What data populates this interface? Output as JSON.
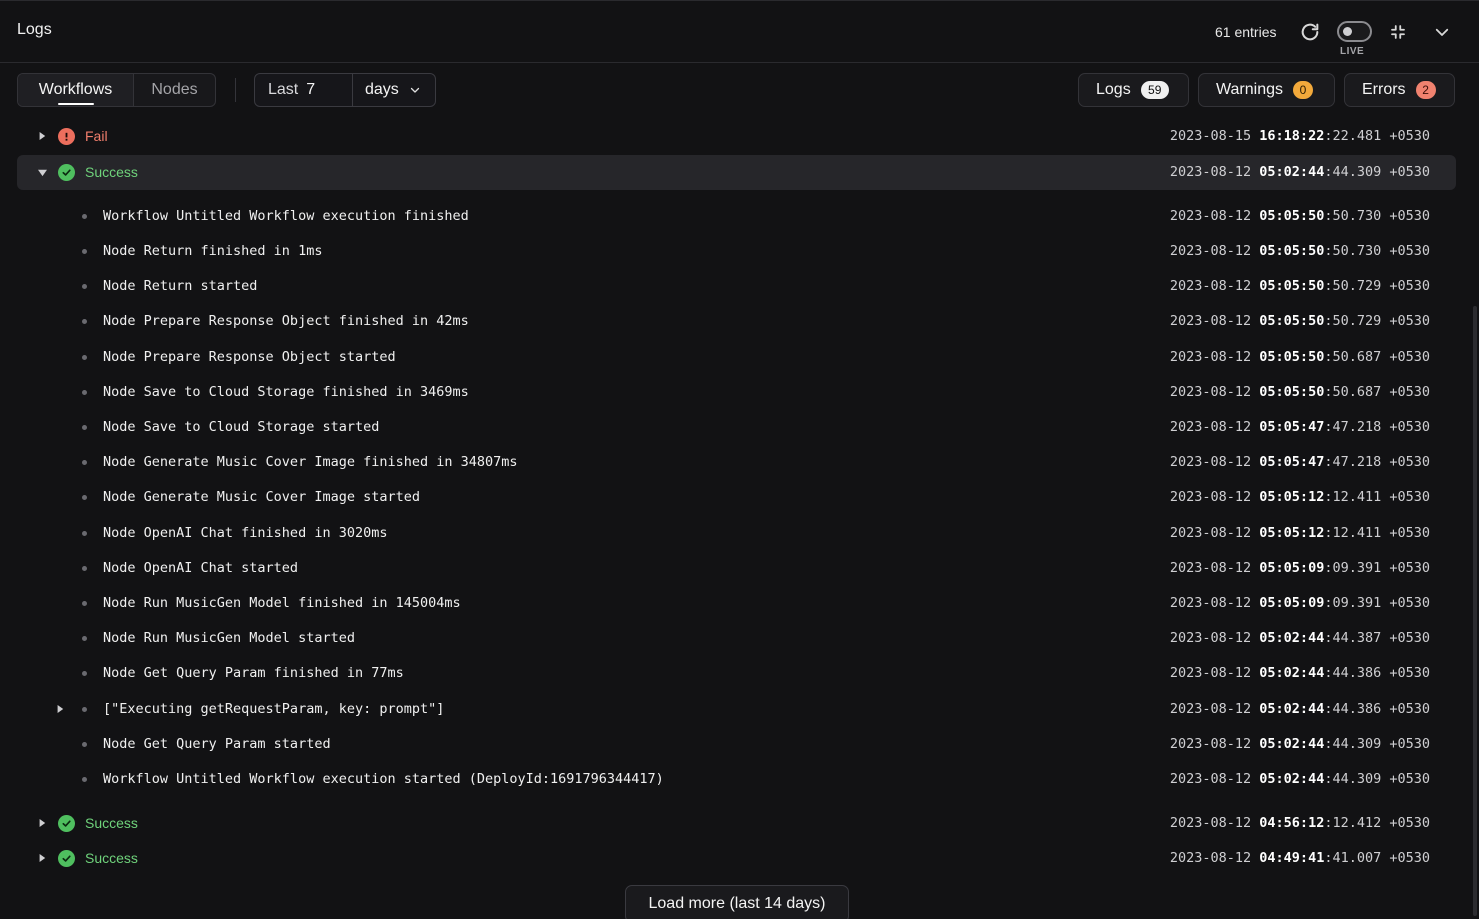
{
  "header": {
    "title": "Logs",
    "entries_count": "61 entries",
    "live_label": "LIVE",
    "live_enabled": false
  },
  "toolbar": {
    "tabs": [
      {
        "label": "Workflows",
        "active": true
      },
      {
        "label": "Nodes",
        "active": false
      }
    ],
    "range": {
      "prefix": "Last",
      "value": "7",
      "unit": "days"
    },
    "filters": [
      {
        "label": "Logs",
        "count": "59",
        "color": "#f1f1f1"
      },
      {
        "label": "Warnings",
        "count": "0",
        "color": "#f2a93b"
      },
      {
        "label": "Errors",
        "count": "2",
        "color": "#f0826f"
      }
    ]
  },
  "runs": [
    {
      "status": "Fail",
      "kind": "fail",
      "expanded": false,
      "ts_date": "2023-08-15",
      "ts_bold": "16:18:22",
      "ts_rest": ":22.481 +0530"
    },
    {
      "status": "Success",
      "kind": "ok",
      "expanded": true,
      "ts_date": "2023-08-12",
      "ts_bold": "05:02:44",
      "ts_rest": ":44.309 +0530"
    },
    {
      "status": "Success",
      "kind": "ok",
      "expanded": false,
      "ts_date": "2023-08-12",
      "ts_bold": "04:56:12",
      "ts_rest": ":12.412 +0530"
    },
    {
      "status": "Success",
      "kind": "ok",
      "expanded": false,
      "ts_date": "2023-08-12",
      "ts_bold": "04:49:41",
      "ts_rest": ":41.007 +0530"
    }
  ],
  "entries": [
    {
      "msg": "Workflow Untitled Workflow execution finished",
      "ts_date": "2023-08-12",
      "ts_bold": "05:05:50",
      "ts_rest": ":50.730 +0530"
    },
    {
      "msg": "Node Return finished in 1ms",
      "ts_date": "2023-08-12",
      "ts_bold": "05:05:50",
      "ts_rest": ":50.730 +0530"
    },
    {
      "msg": "Node Return started",
      "ts_date": "2023-08-12",
      "ts_bold": "05:05:50",
      "ts_rest": ":50.729 +0530"
    },
    {
      "msg": "Node Prepare Response Object finished in 42ms",
      "ts_date": "2023-08-12",
      "ts_bold": "05:05:50",
      "ts_rest": ":50.729 +0530"
    },
    {
      "msg": "Node Prepare Response Object started",
      "ts_date": "2023-08-12",
      "ts_bold": "05:05:50",
      "ts_rest": ":50.687 +0530"
    },
    {
      "msg": "Node Save to Cloud Storage finished in 3469ms",
      "ts_date": "2023-08-12",
      "ts_bold": "05:05:50",
      "ts_rest": ":50.687 +0530"
    },
    {
      "msg": "Node Save to Cloud Storage started",
      "ts_date": "2023-08-12",
      "ts_bold": "05:05:47",
      "ts_rest": ":47.218 +0530"
    },
    {
      "msg": "Node Generate Music Cover Image finished in 34807ms",
      "ts_date": "2023-08-12",
      "ts_bold": "05:05:47",
      "ts_rest": ":47.218 +0530"
    },
    {
      "msg": "Node Generate Music Cover Image started",
      "ts_date": "2023-08-12",
      "ts_bold": "05:05:12",
      "ts_rest": ":12.411 +0530"
    },
    {
      "msg": "Node OpenAI Chat finished in 3020ms",
      "ts_date": "2023-08-12",
      "ts_bold": "05:05:12",
      "ts_rest": ":12.411 +0530"
    },
    {
      "msg": "Node OpenAI Chat started",
      "ts_date": "2023-08-12",
      "ts_bold": "05:05:09",
      "ts_rest": ":09.391 +0530"
    },
    {
      "msg": "Node Run MusicGen Model finished in 145004ms",
      "ts_date": "2023-08-12",
      "ts_bold": "05:05:09",
      "ts_rest": ":09.391 +0530"
    },
    {
      "msg": "Node Run MusicGen Model started",
      "ts_date": "2023-08-12",
      "ts_bold": "05:02:44",
      "ts_rest": ":44.387 +0530"
    },
    {
      "msg": "Node Get Query Param finished in 77ms",
      "ts_date": "2023-08-12",
      "ts_bold": "05:02:44",
      "ts_rest": ":44.386 +0530"
    },
    {
      "msg": "[\"Executing getRequestParam, key: prompt\"]",
      "expandable": true,
      "ts_date": "2023-08-12",
      "ts_bold": "05:02:44",
      "ts_rest": ":44.386 +0530"
    },
    {
      "msg": "Node Get Query Param started",
      "ts_date": "2023-08-12",
      "ts_bold": "05:02:44",
      "ts_rest": ":44.309 +0530"
    },
    {
      "msg": "Workflow Untitled Workflow execution started (DeployId:1691796344417)",
      "ts_date": "2023-08-12",
      "ts_bold": "05:02:44",
      "ts_rest": ":44.309 +0530"
    }
  ],
  "footer": {
    "load_more_label": "Load more (last 14 days)"
  },
  "icons": {
    "refresh": "refresh-icon",
    "collapse": "collapse-icon",
    "chevron": "chevron-down-icon",
    "fail": "alert-circle-icon",
    "success": "check-circle-icon"
  }
}
